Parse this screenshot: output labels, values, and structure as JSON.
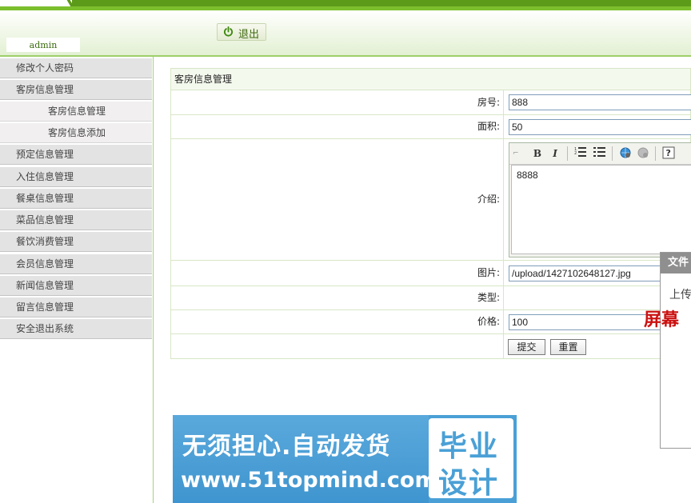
{
  "header": {
    "username": "admin",
    "logout_label": "退出"
  },
  "sidebar": {
    "items": [
      {
        "label": "修改个人密码"
      },
      {
        "label": "客房信息管理"
      },
      {
        "label": "客房信息管理"
      },
      {
        "label": "客房信息添加"
      },
      {
        "label": "预定信息管理"
      },
      {
        "label": "入住信息管理"
      },
      {
        "label": "餐桌信息管理"
      },
      {
        "label": "菜品信息管理"
      },
      {
        "label": "餐饮消费管理"
      },
      {
        "label": "会员信息管理"
      },
      {
        "label": "新闻信息管理"
      },
      {
        "label": "留言信息管理"
      },
      {
        "label": "安全退出系统"
      }
    ]
  },
  "form": {
    "title": "客房信息管理",
    "room_no": {
      "label": "房号:",
      "value": "888"
    },
    "area": {
      "label": "面积:",
      "value": "50"
    },
    "intro": {
      "label": "介绍:",
      "value": "8888"
    },
    "image": {
      "label": "图片:",
      "value": "/upload/1427102648127.jpg"
    },
    "type": {
      "label": "类型:"
    },
    "price": {
      "label": "价格:",
      "value": "100"
    },
    "submit_label": "提交",
    "reset_label": "重置"
  },
  "editor_toolbar": [
    "bold-icon",
    "italic-icon",
    "ordered-list-icon",
    "unordered-list-icon",
    "link-icon",
    "unlink-icon",
    "help-icon"
  ],
  "dialog": {
    "title": "文件",
    "message": "上传",
    "red_text": "屏幕"
  },
  "banner": {
    "line1": "无须担心.自动发货",
    "line2": "www.51topmind.com",
    "right_top": "毕业",
    "right_bottom": "设计"
  },
  "colors": {
    "header_green": "#5c9a1a",
    "menu_bg": "#e3e3e3",
    "banner_blue": "#4aa0d6",
    "alert_red": "#cc1111"
  }
}
